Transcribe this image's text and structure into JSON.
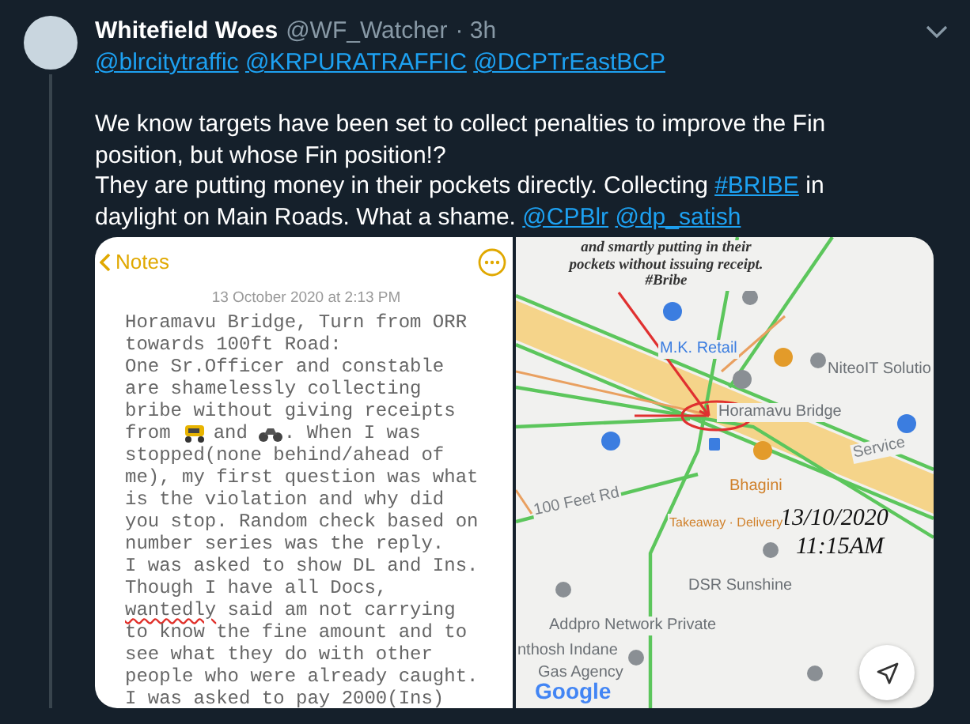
{
  "tweet": {
    "author": "Whitefield Woes",
    "handle": "@WF_Watcher",
    "time": "· 3h",
    "mentions": [
      "@blrcitytraffic",
      "@KRPURATRAFFIC",
      "@DCPTrEastBCP"
    ],
    "paragraphs": [
      [
        {
          "kind": "plain",
          "text": "We know targets have been set to collect penalties to improve the Fin position, but whose Fin position!?"
        }
      ],
      [
        {
          "kind": "plain",
          "text": "They are putting money in their pockets directly. Collecting "
        },
        {
          "kind": "hashtag",
          "text": "#BRIBE"
        },
        {
          "kind": "plain",
          "text": " in daylight on Main Roads. What a shame. "
        },
        {
          "kind": "mention",
          "text": "@CPBlr"
        },
        {
          "kind": "mention",
          "text": "@dp_satish"
        }
      ]
    ]
  },
  "notes": {
    "back": "Notes",
    "date": "13 October 2020 at 2:13 PM",
    "lines": [
      {
        "kind": "text",
        "text": "Horamavu Bridge, Turn from ORR"
      },
      {
        "kind": "text",
        "text": "towards 100ft Road:"
      },
      {
        "kind": "text",
        "text": "One Sr.Officer and constable"
      },
      {
        "kind": "text",
        "text": "are shamelessly collecting"
      },
      {
        "kind": "text",
        "text": "bribe without giving receipts"
      },
      {
        "kind": "icons",
        "parts": [
          "from",
          "and",
          ". When I was"
        ]
      },
      {
        "kind": "text",
        "text": "stopped(none behind/ahead of"
      },
      {
        "kind": "text",
        "text": "me), my first question was what"
      },
      {
        "kind": "text",
        "text": "is the violation and why did"
      },
      {
        "kind": "text",
        "text": "you stop. Random check based on"
      },
      {
        "kind": "text",
        "text": "number series was the reply."
      },
      {
        "kind": "text",
        "text": "I was asked to show DL and Ins."
      },
      {
        "kind": "text",
        "text": "Though I have all Docs,"
      },
      {
        "kind": "misspelled",
        "parts": [
          "wantedly",
          " said am not carrying"
        ]
      },
      {
        "kind": "text",
        "text": "to know the fine amount and to"
      },
      {
        "kind": "text",
        "text": "see what they do with other"
      },
      {
        "kind": "text",
        "text": "people who were already caught."
      },
      {
        "kind": "text",
        "text": "I was asked to pay 2000(Ins)"
      }
    ]
  },
  "map": {
    "annotation": [
      "and smartly putting in their",
      "pockets without issuing receipt.",
      "#Bribe"
    ],
    "stamp": [
      "13/10/2020",
      "11:15AM"
    ],
    "labels": [
      {
        "text": "M.K. Retail",
        "kind": "blue"
      },
      {
        "text": "NiteoIT Solutio",
        "kind": "gray"
      },
      {
        "text": "Horamavu Bridge",
        "kind": "gray"
      },
      {
        "text": "Service",
        "kind": "road"
      },
      {
        "text": "Bhagini",
        "kind": "orange"
      },
      {
        "text": "Takeaway · Delivery",
        "kind": "orangesmall"
      },
      {
        "text": "100 Feet Rd",
        "kind": "road"
      },
      {
        "text": "DSR Sunshine",
        "kind": "gray"
      },
      {
        "text": "Addpro Network Private",
        "kind": "gray"
      },
      {
        "text": "nthosh Indane",
        "kind": "gray"
      },
      {
        "text": "Gas Agency",
        "kind": "gray"
      }
    ],
    "logo": "Google"
  }
}
